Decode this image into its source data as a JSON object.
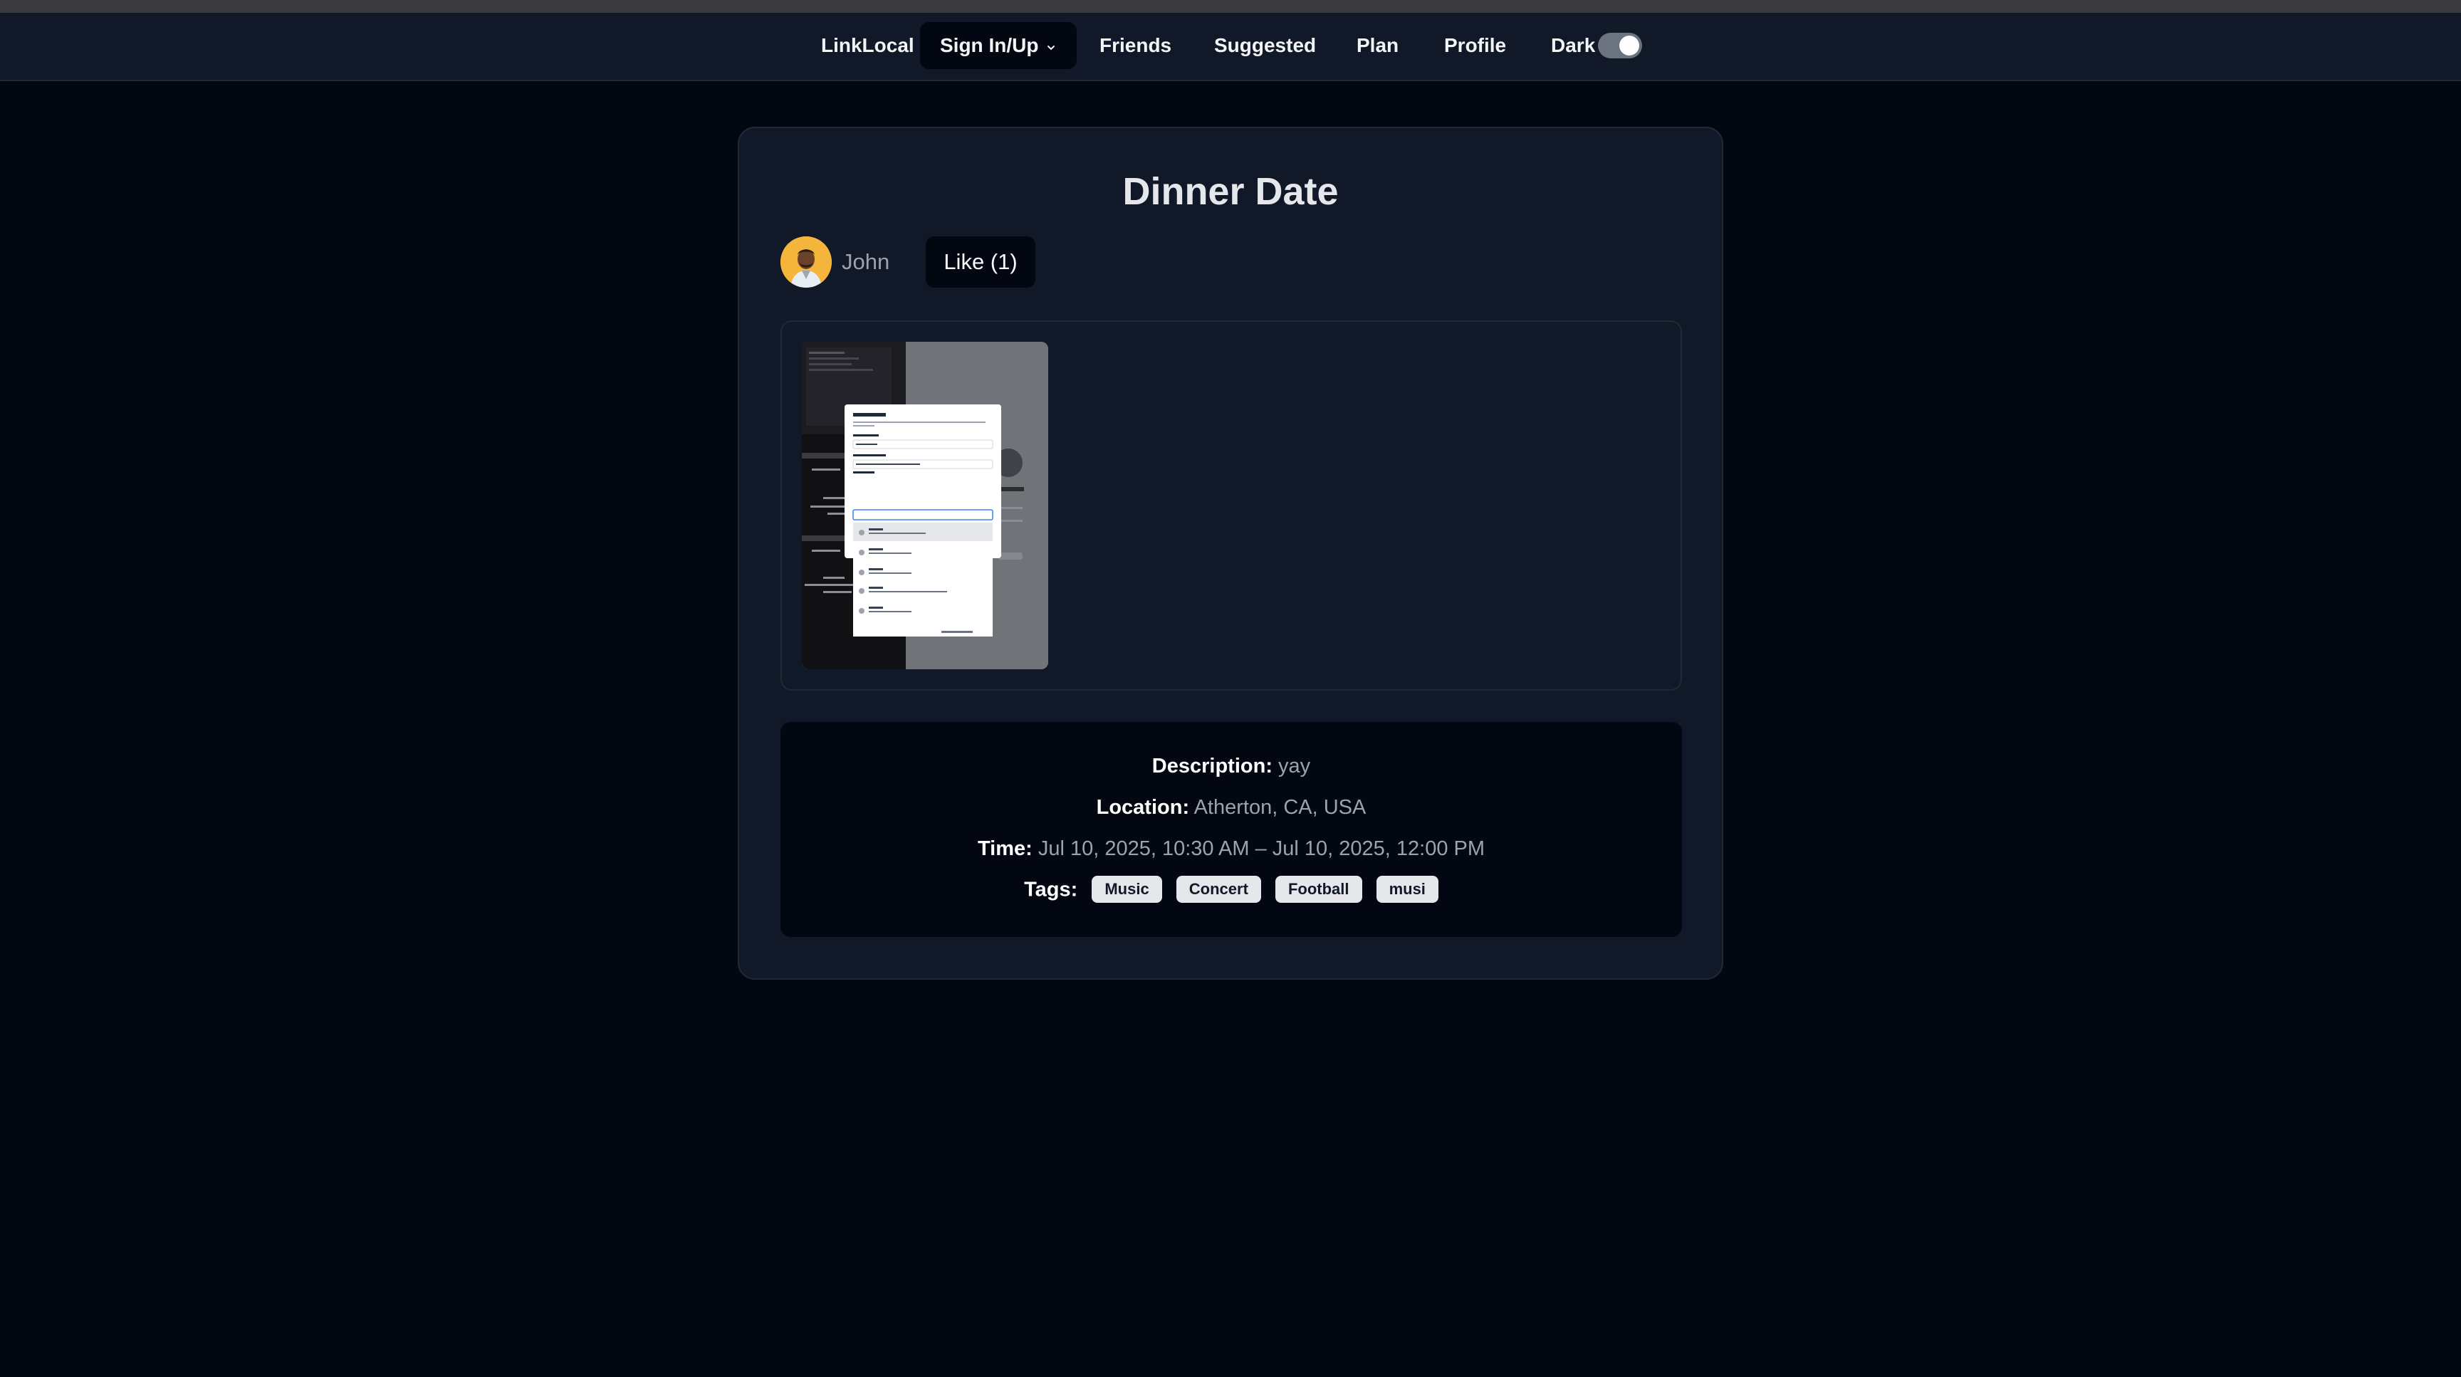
{
  "nav": {
    "brand": "LinkLocal",
    "signin": "Sign In/Up",
    "friends": "Friends",
    "suggested": "Suggested",
    "plan": "Plan",
    "profile": "Profile",
    "theme_label": "Dark",
    "dark_mode_enabled": true
  },
  "event": {
    "title": "Dinner Date",
    "author": "John",
    "like_label": "Like (1)",
    "description_label": "Description:",
    "description": "yay",
    "location_label": "Location:",
    "location": "Atherton, CA, USA",
    "time_label": "Time:",
    "time": "Jul 10, 2025, 10:30 AM – Jul 10, 2025, 12:00 PM",
    "tags_label": "Tags:",
    "tags": [
      "Music",
      "Concert",
      "Football",
      "musi"
    ]
  },
  "colors": {
    "background": "#030712",
    "card": "#111827",
    "border": "#1f2937",
    "muted_text": "#9ca3af",
    "tag_bg": "#e5e7eb"
  }
}
